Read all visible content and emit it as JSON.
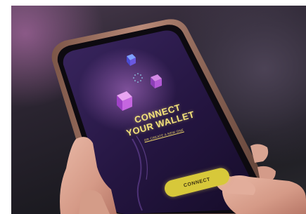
{
  "screen": {
    "title_line1": "CONNECT",
    "title_line2": "YOUR WALLET",
    "create_link": "OR CREATE A NEW ONE",
    "connect_button": "CONNECT"
  },
  "colors": {
    "screen_background": "#2a1845",
    "accent_yellow": "#d7c83a",
    "phone_case": "#b98a78"
  },
  "icons": [
    "cube-icon",
    "cube-icon",
    "cube-icon",
    "dots-circle-icon"
  ]
}
